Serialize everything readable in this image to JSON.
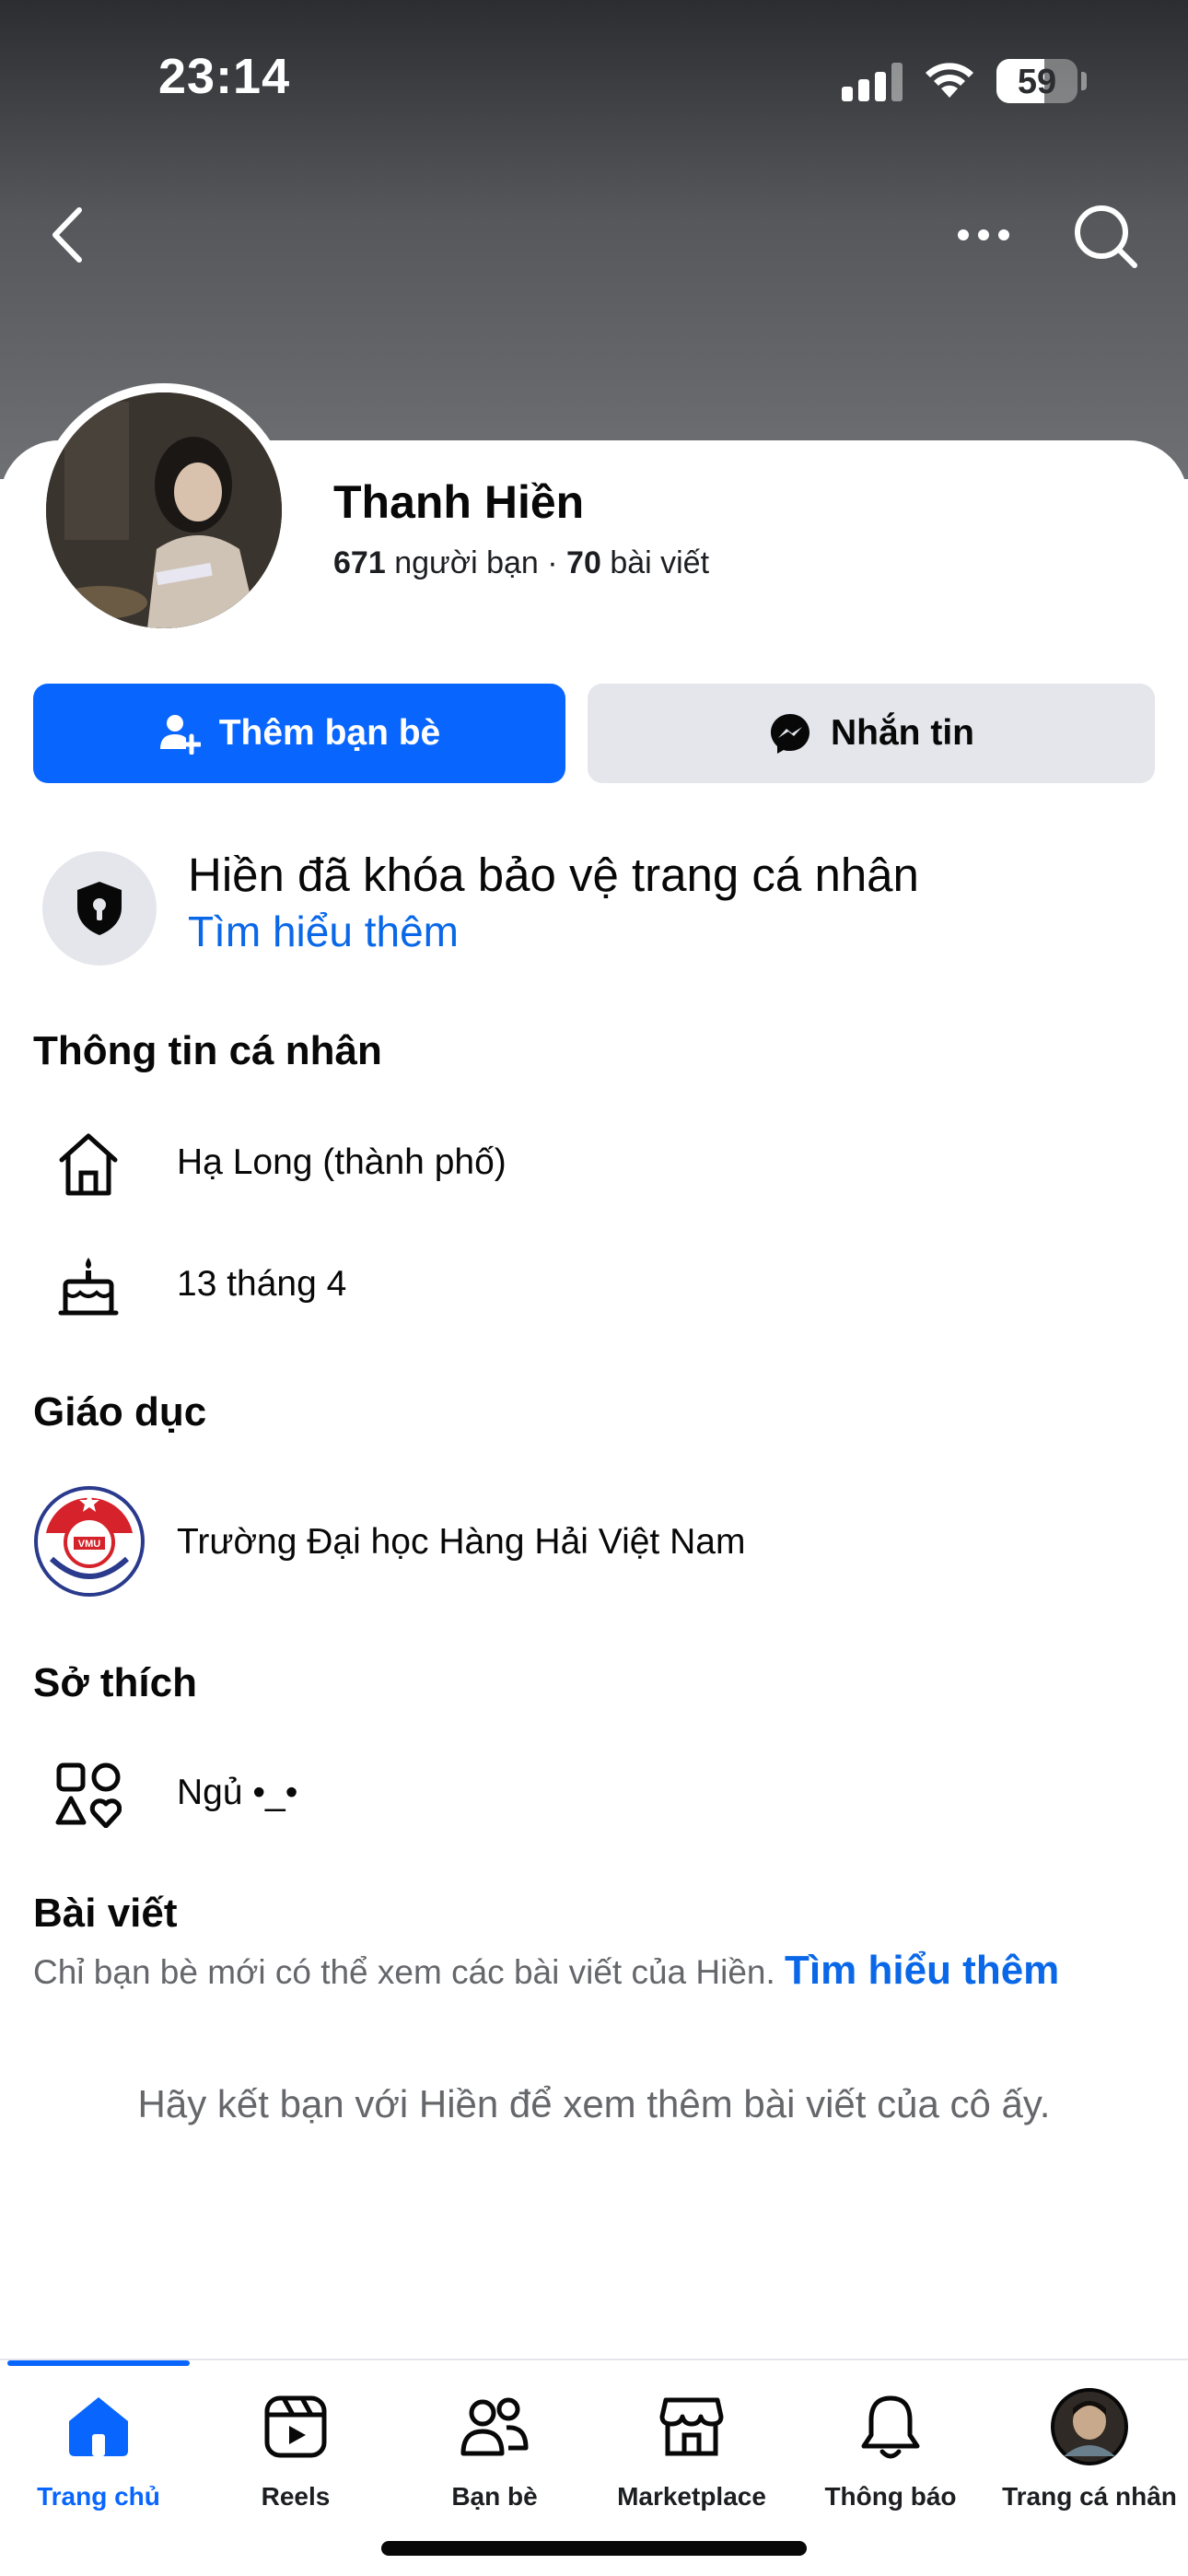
{
  "status_bar": {
    "time": "23:14",
    "battery_percent": "59",
    "battery_level": 0.59
  },
  "header": {
    "back_icon": "chevron-left-icon",
    "more_icon": "more-horizontal-icon",
    "search_icon": "search-icon"
  },
  "profile": {
    "name": "Thanh Hiền",
    "friends_count": "671",
    "friends_label": "người bạn",
    "separator": "·",
    "posts_count": "70",
    "posts_label": "bài viết"
  },
  "actions": {
    "add_friend_label": "Thêm bạn bè",
    "message_label": "Nhắn tin"
  },
  "lock_notice": {
    "title": "Hiền đã khóa bảo vệ trang cá nhân",
    "link": "Tìm hiểu thêm"
  },
  "personal_info": {
    "title": "Thông tin cá nhân",
    "items": [
      {
        "icon": "home-icon",
        "text": "Hạ Long (thành phố)"
      },
      {
        "icon": "birthday-cake-icon",
        "text": "13 tháng 4"
      }
    ]
  },
  "education": {
    "title": "Giáo dục",
    "items": [
      {
        "icon": "school-logo",
        "text": "Trường Đại học Hàng Hải Việt Nam",
        "logo_text": "VMU"
      }
    ]
  },
  "hobbies": {
    "title": "Sở thích",
    "items": [
      {
        "icon": "hobbies-icon",
        "text": "Ngủ •_•"
      }
    ]
  },
  "posts": {
    "title": "Bài viết",
    "note": "Chỉ bạn bè mới có thể xem các bài viết của Hiền.",
    "note_link": "Tìm hiểu thêm",
    "empty_message": "Hãy kết bạn với Hiền để xem thêm bài viết của cô ấy."
  },
  "tabbar": {
    "tabs": [
      {
        "label": "Trang chủ",
        "icon": "home-tab-icon",
        "active": true
      },
      {
        "label": "Reels",
        "icon": "reels-icon"
      },
      {
        "label": "Bạn bè",
        "icon": "friends-icon"
      },
      {
        "label": "Marketplace",
        "icon": "marketplace-icon"
      },
      {
        "label": "Thông báo",
        "icon": "bell-icon"
      },
      {
        "label": "Trang cá nhân",
        "icon": "profile-avatar"
      }
    ]
  },
  "colors": {
    "primary": "#0866ff",
    "link": "#0a68e8",
    "secondary_text": "#65676b",
    "button_gray": "#e4e6eb"
  }
}
